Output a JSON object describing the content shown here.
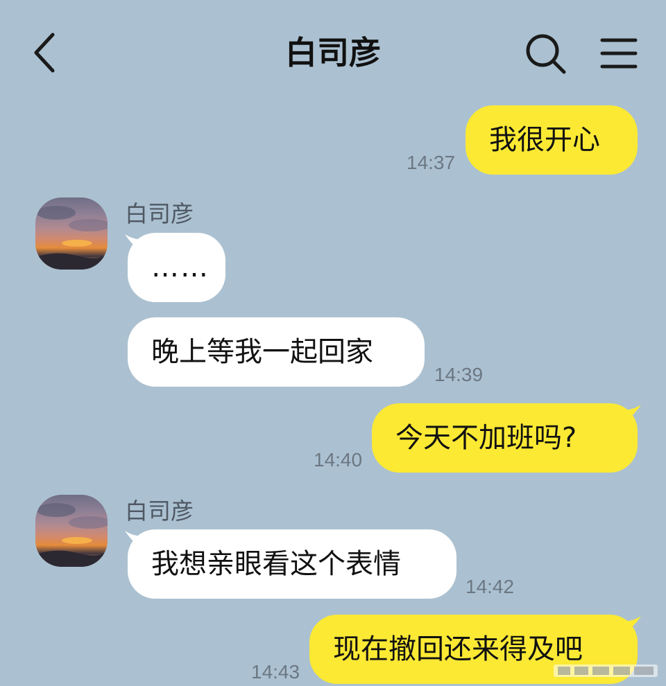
{
  "header": {
    "title": "白司彦"
  },
  "messages": [
    {
      "side": "me",
      "text": "我很开心",
      "time": "14:37"
    },
    {
      "side": "other",
      "sender": "白司彦",
      "text": "……"
    },
    {
      "side": "other",
      "text": "晚上等我一起回家",
      "time": "14:39"
    },
    {
      "side": "me",
      "text": "今天不加班吗?",
      "time": "14:40"
    },
    {
      "side": "other",
      "sender": "白司彦",
      "text": "我想亲眼看这个表情",
      "time": "14:42"
    },
    {
      "side": "me",
      "text": "现在撤回还来得及吧",
      "time": "14:43"
    }
  ],
  "colors": {
    "background": "#abc1d1",
    "my_bubble": "#fbe934",
    "other_bubble": "#ffffff"
  }
}
